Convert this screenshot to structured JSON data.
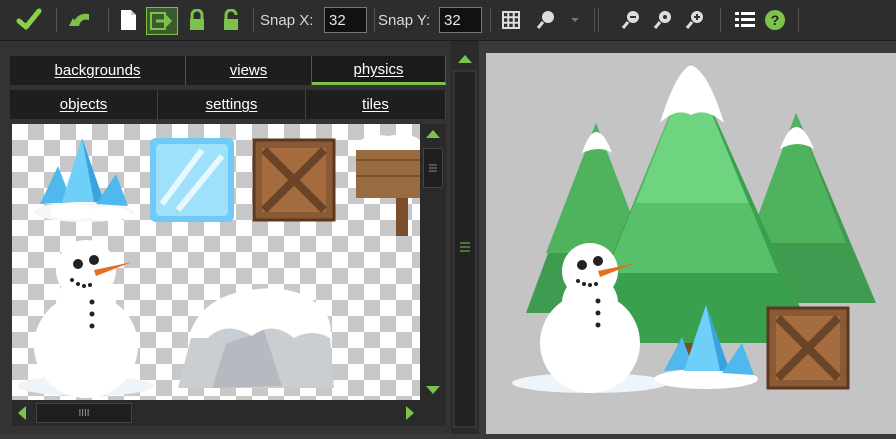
{
  "toolbar": {
    "snap_x_label": "Snap X:",
    "snap_x_value": "32",
    "snap_y_label": "Snap Y:",
    "snap_y_value": "32",
    "icons": [
      "confirm-check-icon",
      "undo-icon",
      "new-document-icon",
      "shift-arrow-icon",
      "lock-icon",
      "unlock-icon",
      "grid-icon",
      "zoom-dropdown-icon",
      "zoom-out-icon",
      "zoom-reset-icon",
      "zoom-in-icon",
      "list-icon",
      "help-icon"
    ]
  },
  "tabs": {
    "row1": [
      "backgrounds",
      "views",
      "physics"
    ],
    "row2": [
      "objects",
      "settings",
      "tiles"
    ],
    "active": "physics"
  },
  "tileset": {
    "tiles": [
      "ice-crystal",
      "ice-block",
      "wooden-crate",
      "wooden-sign",
      "snowman",
      "snowy-rock"
    ]
  },
  "scrollbar": {
    "thumb_grip": "IIII"
  },
  "room": {
    "objects": [
      "pine-trees",
      "snowman",
      "ice-crystal",
      "wooden-crate"
    ]
  },
  "colors": {
    "accent": "#7dc24b",
    "canvas_bg": "#c4c4c4"
  }
}
